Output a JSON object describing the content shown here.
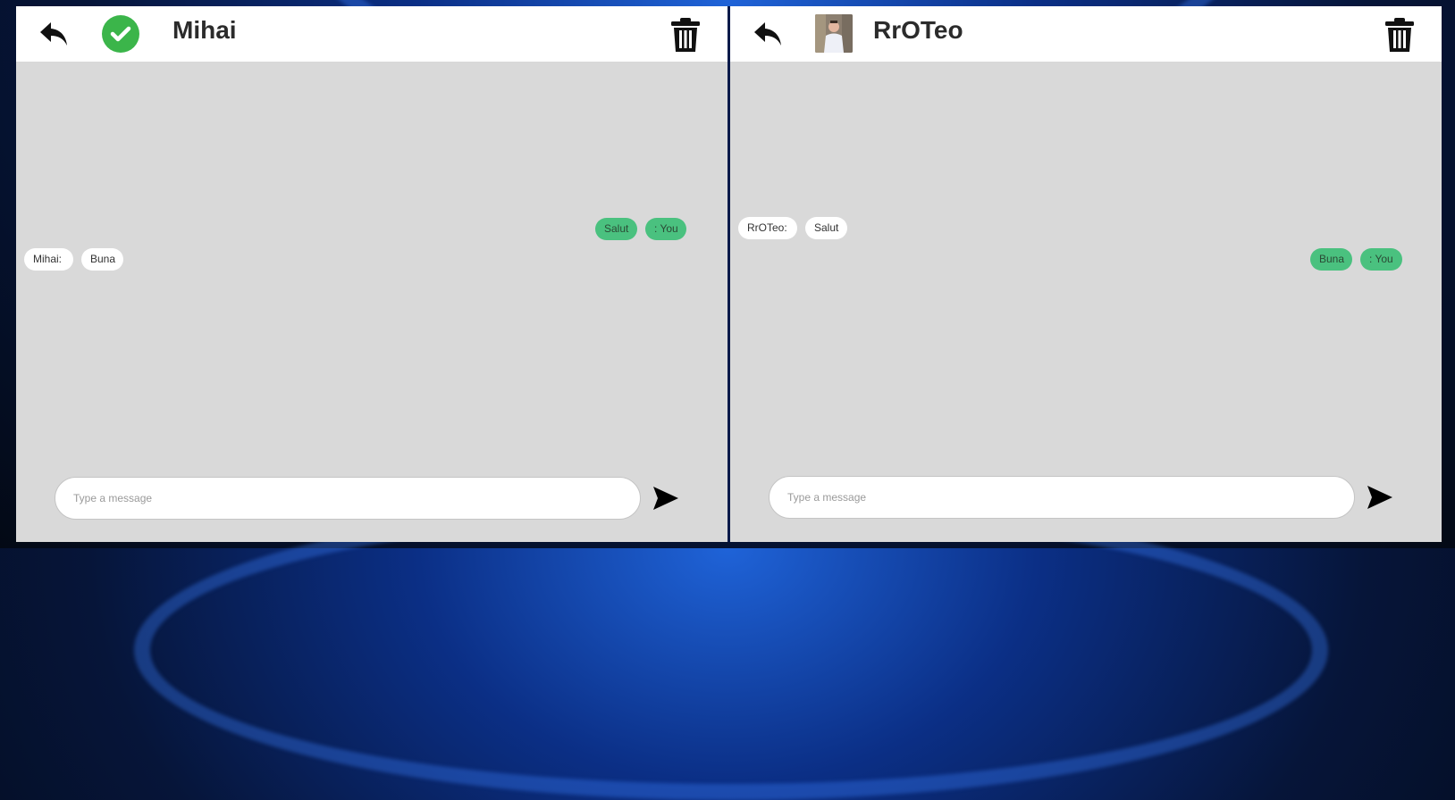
{
  "left_chat": {
    "contact_name": "Mihai",
    "avatar_icon": "check-circle-icon",
    "messages": [
      {
        "side": "right",
        "sender_label": ": You",
        "text": "Salut"
      },
      {
        "side": "left",
        "sender_label": "Mihai:",
        "text": "Buna"
      }
    ],
    "input_placeholder": "Type a message"
  },
  "right_chat": {
    "contact_name": "RrOTeo",
    "avatar_icon": "profile-photo",
    "messages": [
      {
        "side": "left",
        "sender_label": "RrOTeo:",
        "text": "Salut"
      },
      {
        "side": "right",
        "sender_label": ": You",
        "text": "Buna"
      }
    ],
    "input_placeholder": "Type a message"
  },
  "icons": {
    "back": "reply-arrow-icon",
    "delete": "trash-icon",
    "send": "send-icon"
  },
  "colors": {
    "chat_background": "#d9d9d9",
    "own_bubble": "#4ac17f",
    "other_bubble": "#ffffff",
    "check_avatar": "#3bb54a"
  }
}
